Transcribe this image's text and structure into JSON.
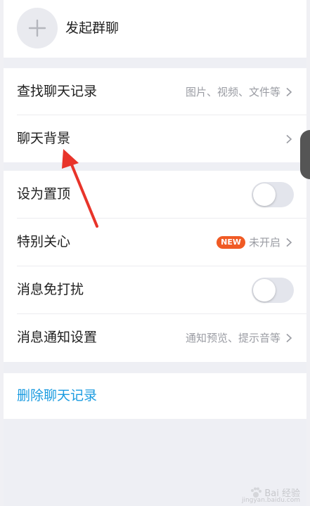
{
  "header": {
    "start_group_chat_label": "发起群聊"
  },
  "settings": {
    "find_history": {
      "label": "查找聊天记录",
      "hint": "图片、视频、文件等"
    },
    "chat_background": {
      "label": "聊天背景"
    },
    "pin_top": {
      "label": "设为置顶",
      "toggle_on": false
    },
    "special_care": {
      "label": "特别关心",
      "badge": "NEW",
      "status": "未开启"
    },
    "do_not_disturb": {
      "label": "消息免打扰",
      "toggle_on": false
    },
    "notification_settings": {
      "label": "消息通知设置",
      "hint": "通知预览、提示音等"
    }
  },
  "danger": {
    "delete_history_label": "删除聊天记录"
  },
  "watermark": {
    "text": "Bai 经验",
    "sub": "jingyan.baidu.com"
  },
  "colors": {
    "accent_link": "#1a9be0",
    "badge": "#f05a24",
    "annotation_arrow": "#e8342a",
    "background": "#eeeff4"
  },
  "icons": {
    "plus": "plus-icon",
    "chevron": "chevron-right-icon",
    "paw": "paw-icon"
  }
}
